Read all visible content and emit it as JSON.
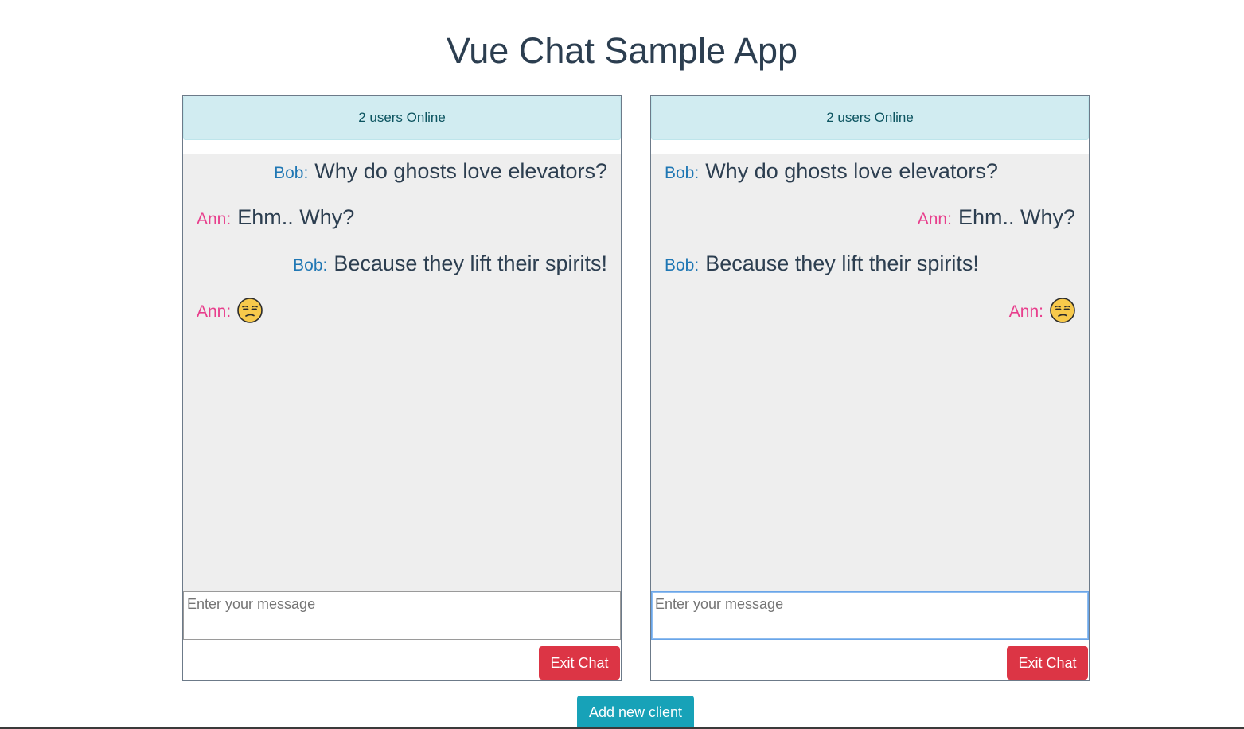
{
  "app": {
    "title": "Vue Chat Sample App"
  },
  "clients": [
    {
      "online_label": "2 users Online",
      "input": {
        "placeholder": "Enter your message",
        "value": ""
      },
      "exit_label": "Exit Chat",
      "messages": [
        {
          "author": "Bob:",
          "text": "Why do ghosts love elevators?",
          "align": "right"
        },
        {
          "author": "Ann:",
          "text": "Ehm.. Why?",
          "align": "left"
        },
        {
          "author": "Bob:",
          "text": "Because they lift their spirits!",
          "align": "right"
        },
        {
          "author": "Ann:",
          "text": "",
          "icon": "unamused-face-emoji",
          "align": "left"
        }
      ]
    },
    {
      "online_label": "2 users Online",
      "input": {
        "placeholder": "Enter your message",
        "value": ""
      },
      "exit_label": "Exit Chat",
      "messages": [
        {
          "author": "Bob:",
          "text": "Why do ghosts love elevators?",
          "align": "left"
        },
        {
          "author": "Ann:",
          "text": "Ehm.. Why?",
          "align": "right"
        },
        {
          "author": "Bob:",
          "text": "Because they lift their spirits!",
          "align": "left"
        },
        {
          "author": "Ann:",
          "text": "",
          "icon": "unamused-face-emoji",
          "align": "right"
        }
      ]
    }
  ],
  "actions": {
    "add_client_label": "Add new client"
  },
  "colors": {
    "bob": "#1f77b4",
    "ann": "#e83e8c",
    "exit_button": "#dc3545",
    "add_button": "#17a2b8",
    "online_bar": "#d1ecf1",
    "messages_bg": "#eeeeee"
  }
}
